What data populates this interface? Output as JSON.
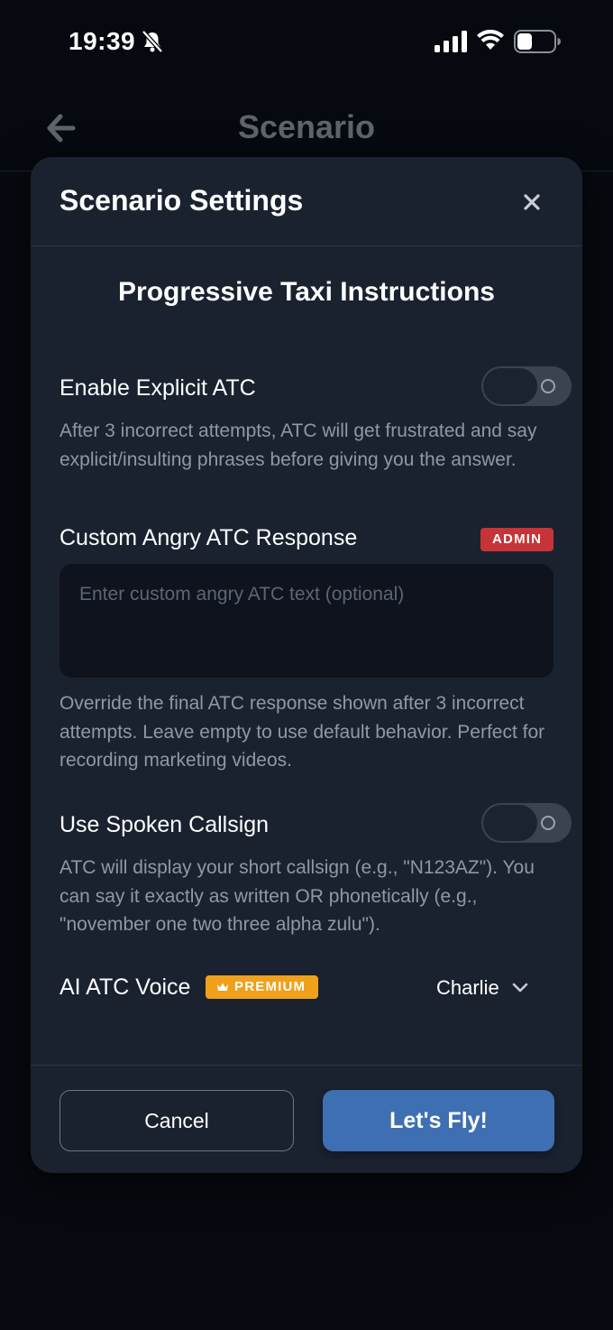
{
  "status_bar": {
    "time": "19:39",
    "icons": [
      "bell-slash-icon",
      "signal-icon",
      "wifi-icon",
      "battery-icon"
    ],
    "battery_level": 0.35
  },
  "nav": {
    "title": "Scenario",
    "back_icon": "arrow-left-icon"
  },
  "modal": {
    "title": "Scenario Settings",
    "close_icon": "close-icon",
    "scenario_name": "Progressive Taxi Instructions",
    "settings": {
      "explicit_atc": {
        "label": "Enable Explicit ATC",
        "enabled": false,
        "description": "After 3 incorrect attempts, ATC will get frustrated and say explicit/insulting phrases before giving you the answer."
      },
      "custom_response": {
        "label": "Custom Angry ATC Response",
        "badge": "ADMIN",
        "value": "",
        "placeholder": "Enter custom angry ATC text (optional)",
        "description": "Override the final ATC response shown after 3 incorrect attempts. Leave empty to use default behavior. Perfect for recording marketing videos."
      },
      "spoken_callsign": {
        "label": "Use Spoken Callsign",
        "enabled": false,
        "description": "ATC will display your short callsign (e.g., \"N123AZ\"). You can say it exactly as written OR phonetically (e.g., \"november one two three alpha zulu\")."
      },
      "ai_voice": {
        "label": "AI ATC Voice",
        "badge": "PREMIUM",
        "value": "Charlie"
      }
    },
    "buttons": {
      "cancel": "Cancel",
      "confirm": "Let's Fly!"
    }
  },
  "colors": {
    "background": "#06090f",
    "modal": "#1a2230",
    "primary_button": "#3e6fb3",
    "admin_badge": "#c63437",
    "premium_badge": "#f0a01b"
  }
}
